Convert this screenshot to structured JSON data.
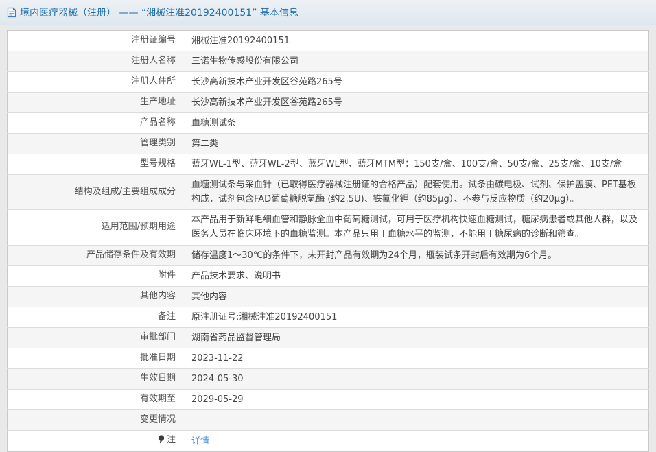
{
  "header": {
    "title": "境内医疗器械（注册） —— “湘械注准20192400151” 基本信息",
    "title_color": "#1b6ca8"
  },
  "table": {
    "rows": [
      {
        "label": "注册证编号",
        "value": "湘械注准20192400151"
      },
      {
        "label": "注册人名称",
        "value": "三诺生物传感股份有限公司"
      },
      {
        "label": "注册人住所",
        "value": "长沙高新技术产业开发区谷苑路265号"
      },
      {
        "label": "生产地址",
        "value": "长沙高新技术产业开发区谷苑路265号"
      },
      {
        "label": "产品名称",
        "value": "血糖测试条"
      },
      {
        "label": "管理类别",
        "value": "第二类"
      },
      {
        "label": "型号规格",
        "value": "蓝牙WL-1型、蓝牙WL-2型、蓝牙WL型、蓝牙MTM型：150支/盒、100支/盒、50支/盒、25支/盒、10支/盒"
      },
      {
        "label": "结构及组成/主要组成成分",
        "value": "血糖测试条与采血针（已取得医疗器械注册证的合格产品）配套使用。试条由碳电极、试剂、保护盖膜、PET基板构成，试剂包含FAD葡萄糖脱氢酶 (约2.5U)、铁氰化钾（约85µg）、不参与反应物质（约20µg）。"
      },
      {
        "label": "适用范围/预期用途",
        "value": "本产品用于新鲜毛细血管和静脉全血中葡萄糖测试，可用于医疗机构快速血糖测试，糖尿病患者或其他人群，以及医务人员在临床环境下的血糖监测。本产品只用于血糖水平的监测，不能用于糖尿病的诊断和筛查。"
      },
      {
        "label": "产品储存条件及有效期",
        "value": "储存温度1～30℃的条件下，未开封产品有效期为24个月，瓶装试条开封后有效期为6个月。"
      },
      {
        "label": "附件",
        "value": "产品技术要求、说明书"
      },
      {
        "label": "其他内容",
        "value": "其他内容"
      },
      {
        "label": "备注",
        "value": "原注册证号:湘械注准20192400151"
      },
      {
        "label": "审批部门",
        "value": "湖南省药品监督管理局"
      },
      {
        "label": "批准日期",
        "value": "2023-11-22"
      },
      {
        "label": "生效日期",
        "value": "2024-05-30"
      },
      {
        "label": "有效期至",
        "value": "2029-05-29"
      },
      {
        "label": "变更情况",
        "value": ""
      },
      {
        "label": "注",
        "value": "详情",
        "is_link": true,
        "label_icon": "note-pin-icon"
      }
    ],
    "link_color": "#4a90d9",
    "alt_row_color": "#f5f5f5"
  }
}
